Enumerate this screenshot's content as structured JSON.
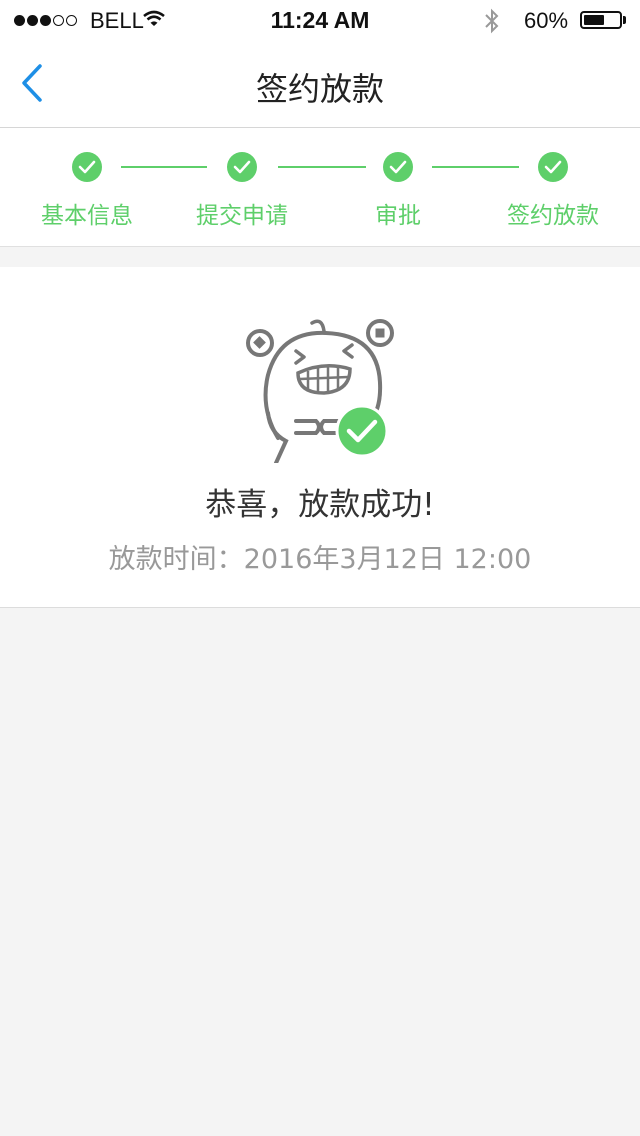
{
  "status_bar": {
    "carrier": "BELL",
    "time": "11:24 AM",
    "battery_percent": "60%",
    "battery_level": 0.6,
    "signal_strength": 3,
    "signal_max": 5
  },
  "nav": {
    "title": "签约放款",
    "back_icon": "chevron-left-icon"
  },
  "steps": [
    {
      "label": "基本信息",
      "done": true
    },
    {
      "label": "提交申请",
      "done": true
    },
    {
      "label": "审批",
      "done": true
    },
    {
      "label": "签约放款",
      "done": true
    }
  ],
  "success": {
    "title": "恭喜，放款成功!",
    "time_text": "放款时间：2016年3月12日 12:00"
  },
  "colors": {
    "accent_green": "#5ecf6a",
    "nav_blue": "#1e8fe6",
    "background": "#f4f4f4"
  }
}
